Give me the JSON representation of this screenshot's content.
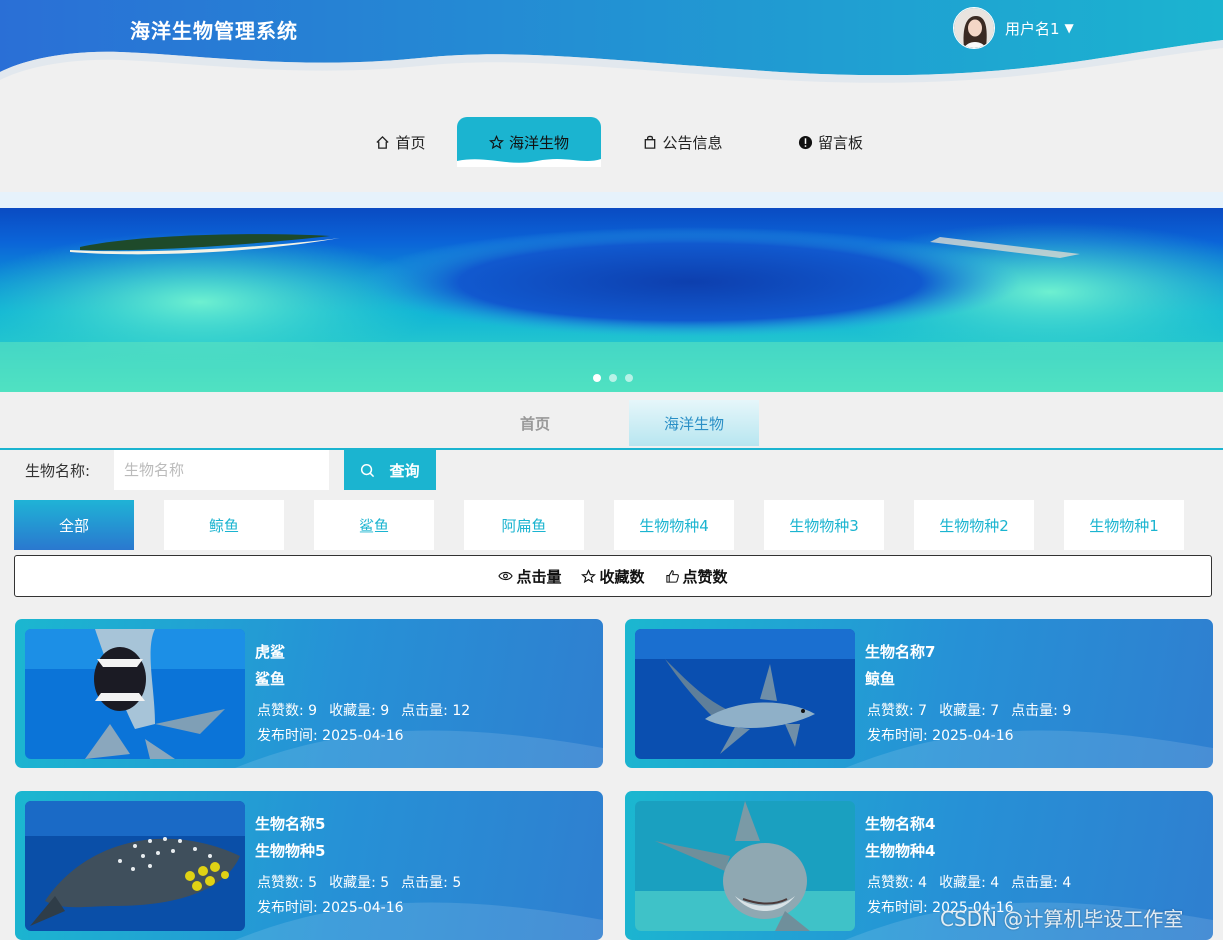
{
  "header": {
    "title": "海洋生物管理系统",
    "username": "用户名1"
  },
  "nav": [
    {
      "label": "首页",
      "icon": "home-icon"
    },
    {
      "label": "海洋生物",
      "icon": "star-icon",
      "active": true
    },
    {
      "label": "公告信息",
      "icon": "bag-icon"
    },
    {
      "label": "留言板",
      "icon": "alert-icon"
    }
  ],
  "banner": {
    "slides": 3,
    "current": 1
  },
  "breadcrumb": {
    "home": "首页",
    "current": "海洋生物"
  },
  "search": {
    "label": "生物名称:",
    "placeholder": "生物名称",
    "button": "查询"
  },
  "categories": [
    "全部",
    "鲸鱼",
    "鲨鱼",
    "阿扁鱼",
    "生物物种4",
    "生物物种3",
    "生物物种2",
    "生物物种1"
  ],
  "sort": [
    {
      "label": "点击量",
      "icon": "eye-icon"
    },
    {
      "label": "收藏数",
      "icon": "star-icon"
    },
    {
      "label": "点赞数",
      "icon": "thumbs-up-icon"
    }
  ],
  "cards": [
    {
      "name": "虎鲨",
      "type": "鲨鱼",
      "likes": "点赞数: 9",
      "favs": "收藏量: 9",
      "clicks": "点击量: 12",
      "date": "发布时间: 2025-04-16"
    },
    {
      "name": "生物名称7",
      "type": "鲸鱼",
      "likes": "点赞数: 7",
      "favs": "收藏量: 7",
      "clicks": "点击量: 9",
      "date": "发布时间: 2025-04-16"
    },
    {
      "name": "生物名称5",
      "type": "生物物种5",
      "likes": "点赞数: 5",
      "favs": "收藏量: 5",
      "clicks": "点击量: 5",
      "date": "发布时间: 2025-04-16"
    },
    {
      "name": "生物名称4",
      "type": "生物物种4",
      "likes": "点赞数: 4",
      "favs": "收藏量: 4",
      "clicks": "点击量: 4",
      "date": "发布时间: 2025-04-16"
    }
  ],
  "watermark": "CSDN @计算机毕设工作室",
  "colors": {
    "accent": "#1bb4d0",
    "header_from": "#2a6fd6",
    "header_to": "#1bb4d0"
  }
}
